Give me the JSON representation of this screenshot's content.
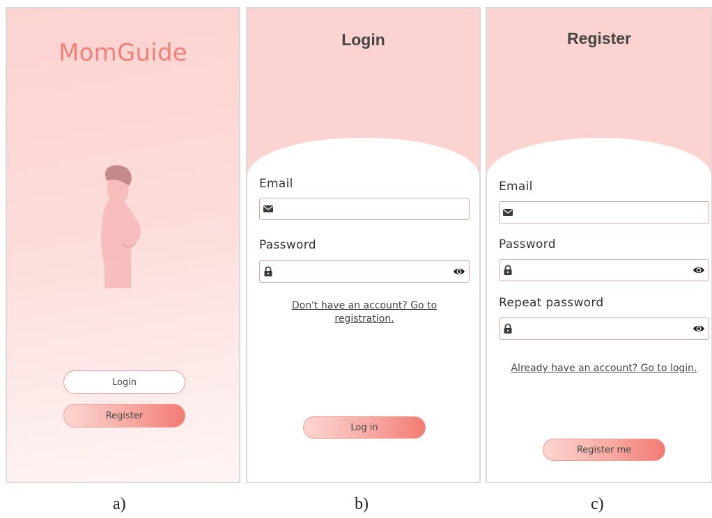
{
  "screen_a": {
    "app_name": "MomGuide",
    "login_button": "Login",
    "register_button": "Register"
  },
  "screen_b": {
    "title": "Login",
    "email_label": "Email",
    "password_label": "Password",
    "registration_link": "Don't have an account? Go to registration.",
    "submit_button": "Log in"
  },
  "screen_c": {
    "title": "Register",
    "email_label": "Email",
    "password_label": "Password",
    "repeat_password_label": "Repeat password",
    "login_link": "Already have an account? Go to login.",
    "submit_button": "Register me"
  },
  "captions": [
    "a)",
    "b)",
    "c)"
  ],
  "icons": {
    "email": "envelope-icon",
    "password": "lock-icon",
    "visibility": "eye-icon"
  },
  "colors": {
    "brand": "#f2807a",
    "background_pink": "#fbd3d0",
    "field_border": "#e0a7a2",
    "button_gradient_end": "#f27b73"
  }
}
